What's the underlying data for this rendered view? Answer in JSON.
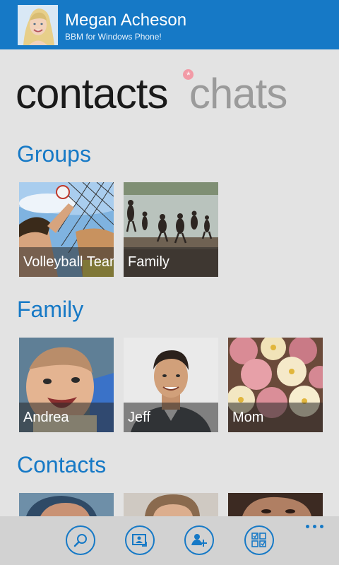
{
  "header": {
    "name": "Megan Acheson",
    "status": "BBM for Windows Phone!"
  },
  "pivot": {
    "tabs": [
      "contacts",
      "chats"
    ],
    "active": "contacts",
    "unread_indicator": "new-chat-dot-icon"
  },
  "sections": {
    "groups": {
      "title": "Groups",
      "tiles": [
        {
          "label": "Volleyball Team"
        },
        {
          "label": "Family"
        }
      ]
    },
    "family": {
      "title": "Family",
      "tiles": [
        {
          "label": "Andrea"
        },
        {
          "label": "Jeff"
        },
        {
          "label": "Mom"
        }
      ]
    },
    "contacts": {
      "title": "Contacts"
    }
  },
  "app_bar": {
    "buttons": [
      "search-icon",
      "contact-card-icon",
      "add-contact-icon",
      "checklist-icon"
    ],
    "more": "more-ellipsis-icon"
  },
  "colors": {
    "accent": "#1679c6",
    "background": "#e3e3e3",
    "app_bar": "#d2d2d2"
  }
}
